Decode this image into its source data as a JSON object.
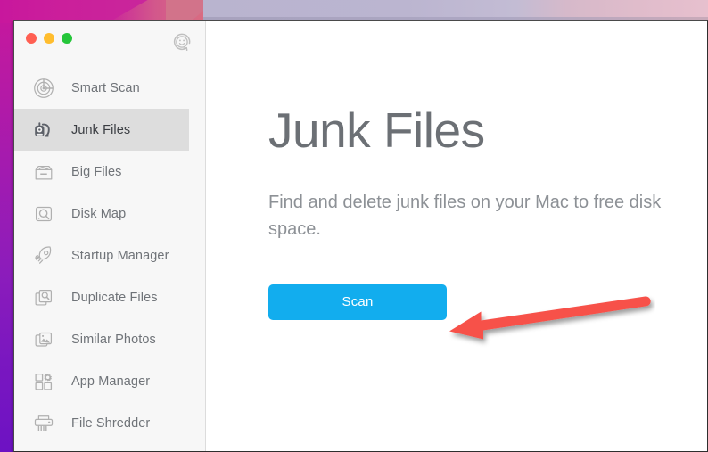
{
  "window": {
    "traffic_lights": [
      {
        "name": "close",
        "color": "#ff5f52"
      },
      {
        "name": "minimize",
        "color": "#ffbd2e"
      },
      {
        "name": "zoom",
        "color": "#25c63a"
      }
    ],
    "support_icon": "smiley-support-icon"
  },
  "sidebar": {
    "items": [
      {
        "label": "Smart Scan",
        "icon": "radar-icon",
        "selected": false
      },
      {
        "label": "Junk Files",
        "icon": "vacuum-icon",
        "selected": true
      },
      {
        "label": "Big Files",
        "icon": "storage-box-icon",
        "selected": false
      },
      {
        "label": "Disk Map",
        "icon": "disk-search-icon",
        "selected": false
      },
      {
        "label": "Startup Manager",
        "icon": "rocket-icon",
        "selected": false
      },
      {
        "label": "Duplicate Files",
        "icon": "documents-search-icon",
        "selected": false
      },
      {
        "label": "Similar Photos",
        "icon": "photos-icon",
        "selected": false
      },
      {
        "label": "App Manager",
        "icon": "app-grid-gear-icon",
        "selected": false
      },
      {
        "label": "File Shredder",
        "icon": "shredder-icon",
        "selected": false
      }
    ]
  },
  "main": {
    "title": "Junk Files",
    "description": "Find and delete junk files on your Mac to free disk space.",
    "scan_button_label": "Scan"
  },
  "annotation": {
    "arrow": "red-arrow-pointing-left",
    "color": "#f7514a"
  },
  "colors": {
    "accent_button": "#12adee",
    "sidebar_bg": "#f7f7f7",
    "selected_row": "#dddddd",
    "title_text": "#6c7075",
    "body_text": "#8d9196",
    "desktop_magenta": "#c8179d",
    "desktop_purple": "#6d12c3",
    "desktop_lavender": "#b9b4cf"
  }
}
